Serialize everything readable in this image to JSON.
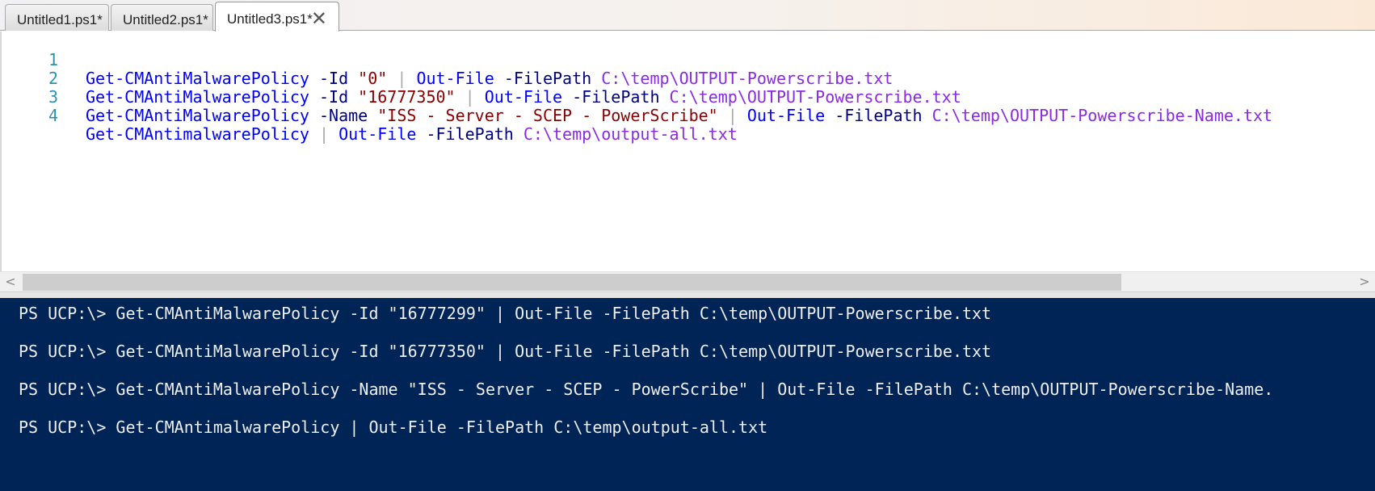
{
  "tabs": [
    {
      "label": "Untitled1.ps1*",
      "active": false
    },
    {
      "label": "Untitled2.ps1*",
      "active": false
    },
    {
      "label": "Untitled3.ps1*",
      "active": true,
      "close_glyph": "✕"
    }
  ],
  "editor": {
    "lines": [
      {
        "number": "1",
        "tokens": [
          "Get-CMAntiMalwarePolicy",
          "-Id",
          "\"0\"",
          "|",
          "Out-File",
          "-FilePath",
          "C:\\temp\\OUTPUT-Powerscribe.txt"
        ]
      },
      {
        "number": "2",
        "tokens": [
          "Get-CMAntiMalwarePolicy",
          "-Id",
          "\"16777350\"",
          "|",
          "Out-File",
          "-FilePath",
          "C:\\temp\\OUTPUT-Powerscribe.txt"
        ]
      },
      {
        "number": "3",
        "tokens": [
          "Get-CMAntiMalwarePolicy",
          "-Name",
          "\"ISS - Server - SCEP - PowerScribe\"",
          "|",
          "Out-File",
          "-FilePath",
          "C:\\temp\\OUTPUT-Powerscribe-Name.txt"
        ]
      },
      {
        "number": "4",
        "tokens": [
          "Get-CMAntimalwarePolicy",
          "|",
          "Out-File",
          "-FilePath",
          "C:\\temp\\output-all.txt"
        ]
      }
    ]
  },
  "scrollbar": {
    "left_arrow": "<",
    "right_arrow": ">"
  },
  "console": {
    "lines": [
      "PS UCP:\\> Get-CMAntiMalwarePolicy -Id \"16777299\" | Out-File -FilePath C:\\temp\\OUTPUT-Powerscribe.txt",
      "PS UCP:\\> Get-CMAntiMalwarePolicy -Id \"16777350\" | Out-File -FilePath C:\\temp\\OUTPUT-Powerscribe.txt",
      "PS UCP:\\> Get-CMAntiMalwarePolicy -Name \"ISS - Server - SCEP - PowerScribe\" | Out-File -FilePath C:\\temp\\OUTPUT-Powerscribe-Name.",
      "PS UCP:\\> Get-CMAntimalwarePolicy | Out-File -FilePath C:\\temp\\output-all.txt"
    ]
  },
  "colors": {
    "console_bg": "#012456",
    "line_number": "#2b91af",
    "cmdlet": "#0000ff",
    "parameter": "#000080",
    "string": "#8b0000",
    "pipe": "#a9a9a9",
    "path": "#8a2be2"
  }
}
